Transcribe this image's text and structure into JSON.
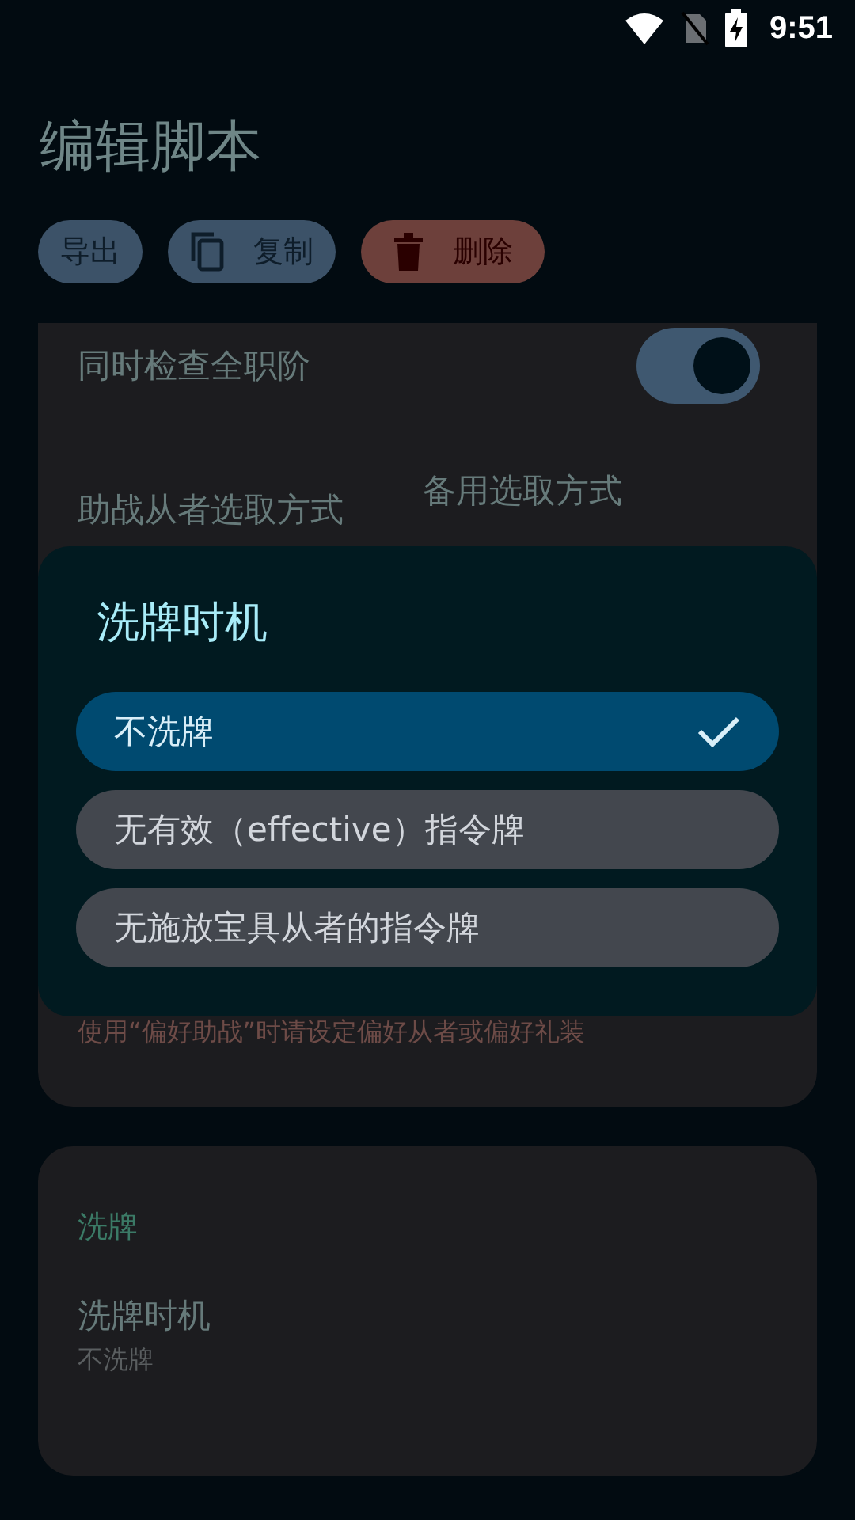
{
  "status_bar": {
    "time": "9:51"
  },
  "title": "编辑脚本",
  "actions": [
    {
      "label": "导出",
      "kind": "plain"
    },
    {
      "label": "复制",
      "kind": "copy"
    },
    {
      "label": "删除",
      "kind": "delete"
    }
  ],
  "settings_card": {
    "switch": {
      "label": "同时检查全职阶",
      "on": true
    },
    "support_selection": {
      "label": "助战从者选取方式"
    },
    "fallback_selection": {
      "label": "备用选取方式"
    },
    "hint": "使用“偏好助战”时请设定偏好从者或偏好礼装"
  },
  "shuffle_card": {
    "section": "洗牌",
    "setting": {
      "label": "洗牌时机",
      "value": "不洗牌"
    }
  },
  "dialog": {
    "title": "洗牌时机",
    "options": [
      {
        "label": "不洗牌",
        "selected": true
      },
      {
        "label": "无有效（effective）指令牌",
        "selected": false
      },
      {
        "label": "无施放宝具从者的指令牌",
        "selected": false
      }
    ]
  }
}
